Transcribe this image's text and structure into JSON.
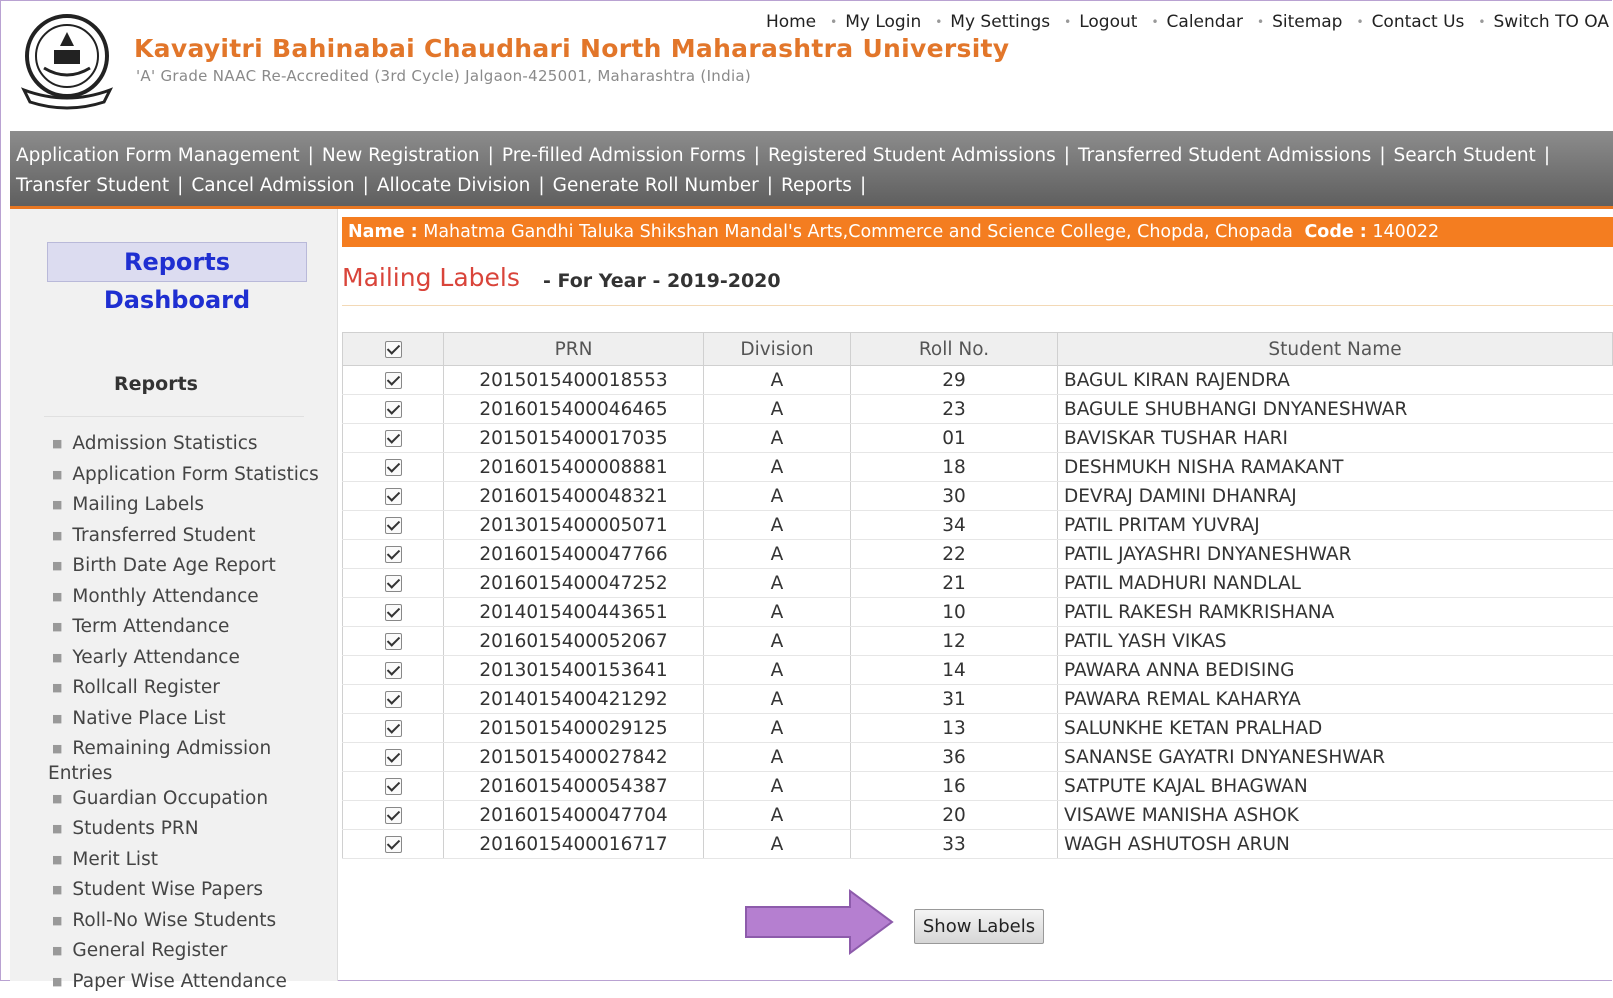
{
  "header": {
    "university": "Kavayitri Bahinabai Chaudhari North Maharashtra University",
    "subtitle": "'A' Grade NAAC Re-Accredited (3rd Cycle) Jalgaon-425001, Maharashtra (India)",
    "links": [
      "Home",
      "My Login",
      "My Settings",
      "Logout",
      "Calendar",
      "Sitemap",
      "Contact Us",
      "Switch TO OA"
    ]
  },
  "nav": {
    "row1": [
      "Application Form Management",
      "New Registration",
      "Pre-filled Admission Forms",
      "Registered Student Admissions",
      "Transferred Student Admissions",
      "Search Student"
    ],
    "row2": [
      "Transfer Student",
      "Cancel Admission",
      "Allocate Division",
      "Generate Roll Number",
      "Reports"
    ]
  },
  "sidebar": {
    "dashboard": "Reports Dashboard",
    "heading": "Reports",
    "items": [
      "Admission Statistics",
      "Application Form Statistics",
      "Mailing Labels",
      "Transferred Student",
      "Birth Date Age Report",
      "Monthly Attendance",
      "Term Attendance",
      "Yearly Attendance",
      "Rollcall Register",
      "Native Place List",
      "Remaining Admission",
      "Guardian Occupation",
      "Students PRN",
      "Merit List",
      "Student Wise Papers",
      "Roll-No Wise Students",
      "General Register",
      "Paper Wise Attendance"
    ],
    "item_wrap": "Entries"
  },
  "college": {
    "name_label": "Name :",
    "name": "Mahatma Gandhi Taluka Shikshan Mandal's Arts,Commerce and Science College, Chopda, Chopada",
    "code_label": "Code :",
    "code": "140022"
  },
  "page": {
    "title": "Mailing Labels",
    "year_text": "- For Year - 2019-2020"
  },
  "table": {
    "headers": [
      "PRN",
      "Division",
      "Roll No.",
      "Student Name"
    ],
    "rows": [
      {
        "prn": "2015015400018553",
        "division": "A",
        "roll": "29",
        "name": "BAGUL KIRAN RAJENDRA"
      },
      {
        "prn": "2016015400046465",
        "division": "A",
        "roll": "23",
        "name": "BAGULE SHUBHANGI DNYANESHWAR"
      },
      {
        "prn": "2015015400017035",
        "division": "A",
        "roll": "01",
        "name": "BAVISKAR TUSHAR HARI"
      },
      {
        "prn": "2016015400008881",
        "division": "A",
        "roll": "18",
        "name": "DESHMUKH NISHA RAMAKANT"
      },
      {
        "prn": "2016015400048321",
        "division": "A",
        "roll": "30",
        "name": "DEVRAJ DAMINI DHANRAJ"
      },
      {
        "prn": "2013015400005071",
        "division": "A",
        "roll": "34",
        "name": "PATIL PRITAM YUVRAJ"
      },
      {
        "prn": "2016015400047766",
        "division": "A",
        "roll": "22",
        "name": "PATIL JAYASHRI DNYANESHWAR"
      },
      {
        "prn": "2016015400047252",
        "division": "A",
        "roll": "21",
        "name": "PATIL MADHURI NANDLAL"
      },
      {
        "prn": "2014015400443651",
        "division": "A",
        "roll": "10",
        "name": "PATIL RAKESH RAMKRISHANA"
      },
      {
        "prn": "2016015400052067",
        "division": "A",
        "roll": "12",
        "name": "PATIL YASH VIKAS"
      },
      {
        "prn": "2013015400153641",
        "division": "A",
        "roll": "14",
        "name": "PAWARA ANNA BEDISING"
      },
      {
        "prn": "2014015400421292",
        "division": "A",
        "roll": "31",
        "name": "PAWARA REMAL KAHARYA"
      },
      {
        "prn": "2015015400029125",
        "division": "A",
        "roll": "13",
        "name": "SALUNKHE KETAN PRALHAD"
      },
      {
        "prn": "2015015400027842",
        "division": "A",
        "roll": "36",
        "name": "SANANSE GAYATRI DNYANESHWAR"
      },
      {
        "prn": "2016015400054387",
        "division": "A",
        "roll": "16",
        "name": "SATPUTE KAJAL BHAGWAN"
      },
      {
        "prn": "2016015400047704",
        "division": "A",
        "roll": "20",
        "name": "VISAWE MANISHA ASHOK"
      },
      {
        "prn": "2016015400016717",
        "division": "A",
        "roll": "33",
        "name": "WAGH ASHUTOSH ARUN"
      }
    ]
  },
  "button": {
    "show_labels": "Show Labels"
  },
  "colors": {
    "accent": "#f47d20",
    "title_red": "#d9443a",
    "link_blue": "#1f2fd1",
    "annotation_arrow": "#b57fd0"
  }
}
